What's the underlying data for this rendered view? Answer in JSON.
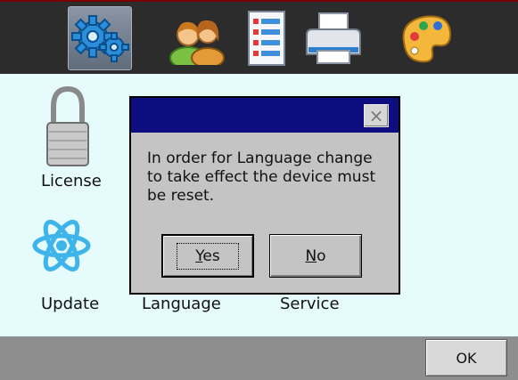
{
  "toolbar": {
    "icons": [
      {
        "name": "settings",
        "icon": "gears-icon",
        "selected": true
      },
      {
        "name": "users",
        "icon": "users-icon",
        "selected": false
      },
      {
        "name": "list",
        "icon": "list-icon",
        "selected": false
      },
      {
        "name": "printer",
        "icon": "printer-icon",
        "selected": false
      },
      {
        "name": "palette",
        "icon": "palette-icon",
        "selected": false
      }
    ]
  },
  "apps": {
    "license_label": "License",
    "update_label": "Update",
    "language_label": "Language",
    "service_label": "Service"
  },
  "dialog": {
    "close_symbol": "×",
    "message": "In order for Language change to take effect the device must be reset.",
    "yes_mnemonic": "Y",
    "yes_rest": "es",
    "no_mnemonic": "N",
    "no_rest": "o"
  },
  "bottom": {
    "ok_label": "OK"
  },
  "colors": {
    "titlebar": "#0d0d80",
    "content_bg": "#e6fbfc",
    "toolbar_bg": "#2c2c2c"
  }
}
